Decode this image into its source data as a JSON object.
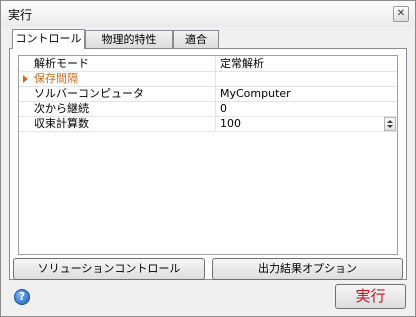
{
  "window": {
    "title": "実行",
    "close_glyph": "✕"
  },
  "tabs": [
    {
      "label": "コントロール",
      "active": true
    },
    {
      "label": "物理的特性",
      "active": false
    },
    {
      "label": "適合",
      "active": false
    }
  ],
  "properties": [
    {
      "name": "解析モード",
      "value": "定常解析"
    },
    {
      "name": "保存間隔",
      "value": "",
      "expandable": true,
      "color": "#d26a1e"
    },
    {
      "name": "ソルバーコンピュータ",
      "value": "MyComputer"
    },
    {
      "name": "次から継続",
      "value": "0"
    },
    {
      "name": "収束計算数",
      "value": "100",
      "spinner": true
    }
  ],
  "buttons": {
    "solution_control": "ソリューションコントロール",
    "output_options": "出力結果オプション",
    "run": "実行"
  },
  "help": {
    "glyph": "?"
  }
}
